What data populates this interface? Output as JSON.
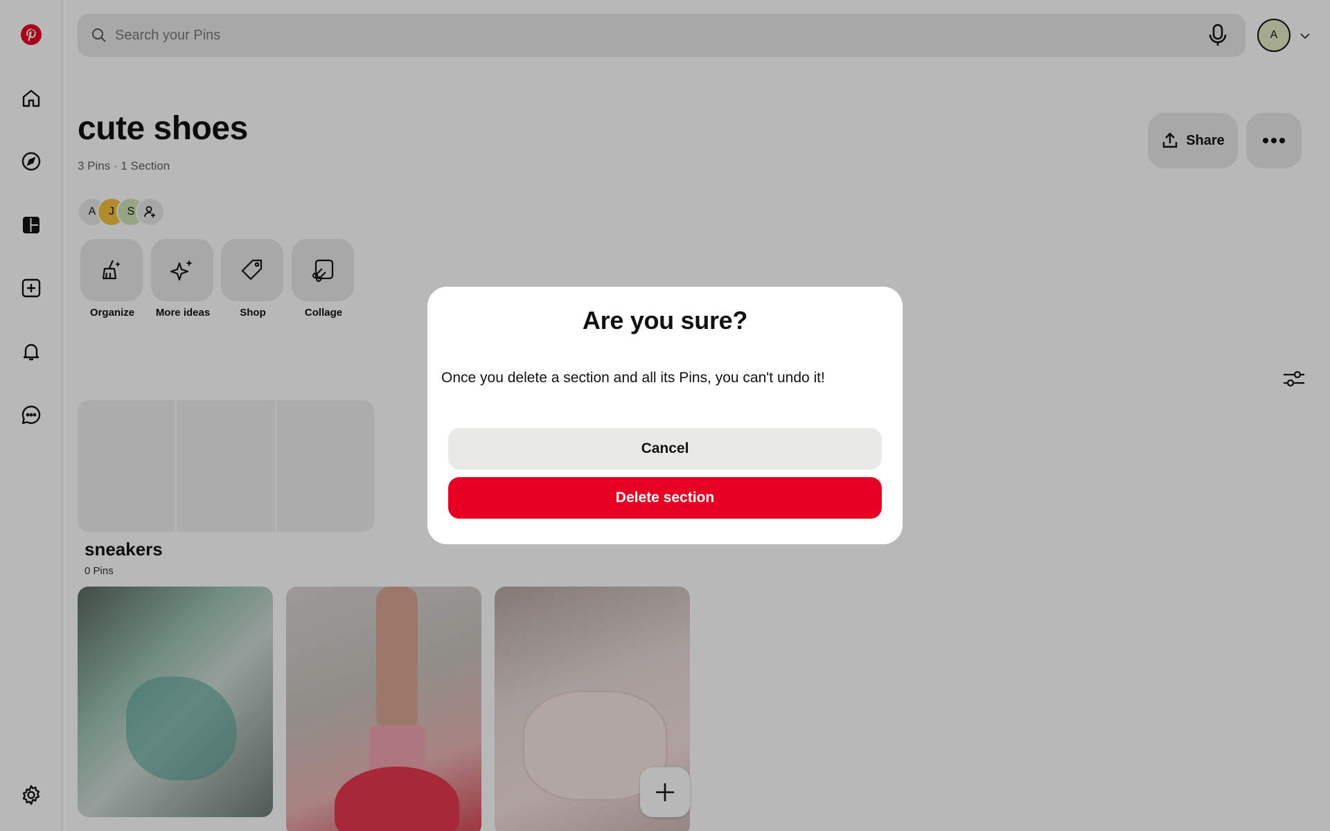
{
  "search": {
    "placeholder": "Search your Pins",
    "icon": "search-icon",
    "mic_icon": "microphone-icon"
  },
  "user": {
    "initial": "A",
    "avatar_color": "#e3ebc8"
  },
  "board": {
    "title": "cute shoes",
    "meta": "3 Pins · 1 Section",
    "share_label": "Share",
    "collaborators": [
      {
        "initial": "A",
        "color": "#e9e9e9"
      },
      {
        "initial": "J",
        "color": "#f5c242"
      },
      {
        "initial": "S",
        "color": "#cfe3b8"
      }
    ]
  },
  "actions": [
    {
      "label": "Organize",
      "icon": "broom-icon"
    },
    {
      "label": "More ideas",
      "icon": "sparkle-icon"
    },
    {
      "label": "Shop",
      "icon": "tag-icon"
    },
    {
      "label": "Collage",
      "icon": "scissors-icon"
    }
  ],
  "section": {
    "name": "sneakers",
    "count": "0 Pins"
  },
  "pins": [
    {
      "description": "teal sandals"
    },
    {
      "description": "red sneakers"
    },
    {
      "description": "pink lolita shoes"
    }
  ],
  "modal": {
    "title": "Are you sure?",
    "message": "Once you delete a section and all its Pins, you can't undo it!",
    "cancel_label": "Cancel",
    "delete_label": "Delete section"
  },
  "colors": {
    "brand": "#e60023",
    "surface": "#e9e9e9"
  }
}
